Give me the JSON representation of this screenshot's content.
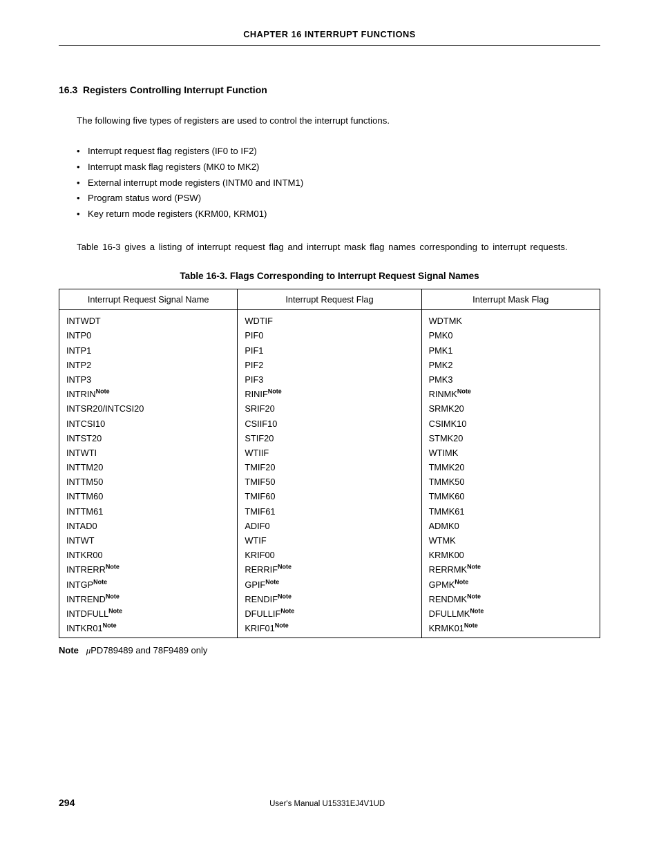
{
  "header": {
    "running": "CHAPTER  16   INTERRUPT  FUNCTIONS"
  },
  "section": {
    "number": "16.3",
    "title": "Registers Controlling Interrupt Function"
  },
  "intro": "The following five types of registers are used to control the interrupt functions.",
  "bullets": [
    "Interrupt request flag registers (IF0 to IF2)",
    "Interrupt mask flag registers (MK0 to MK2)",
    "External interrupt mode registers (INTM0 and INTM1)",
    "Program status word (PSW)",
    "Key return mode registers (KRM00, KRM01)"
  ],
  "paragraph": "Table 16-3 gives a listing of interrupt request flag and interrupt mask flag names corresponding to interrupt requests.",
  "table": {
    "caption": "Table 16-3.  Flags Corresponding to Interrupt Request Signal Names",
    "headers": [
      "Interrupt Request Signal Name",
      "Interrupt Request Flag",
      "Interrupt Mask Flag"
    ],
    "rows": [
      {
        "sig": "INTWDT",
        "req": "WDTIF",
        "mask": "WDTMK"
      },
      {
        "sig": "INTP0",
        "req": "PIF0",
        "mask": "PMK0"
      },
      {
        "sig": "INTP1",
        "req": "PIF1",
        "mask": "PMK1"
      },
      {
        "sig": "INTP2",
        "req": "PIF2",
        "mask": "PMK2"
      },
      {
        "sig": "INTP3",
        "req": "PIF3",
        "mask": "PMK3"
      },
      {
        "sig": "INTRIN",
        "sigNote": true,
        "req": "RINIF",
        "reqNote": true,
        "mask": "RINMK",
        "maskNote": true
      },
      {
        "sig": "INTSR20/INTCSI20",
        "req": "SRIF20",
        "mask": "SRMK20"
      },
      {
        "sig": "INTCSI10",
        "req": "CSIIF10",
        "mask": "CSIMK10"
      },
      {
        "sig": "INTST20",
        "req": "STIF20",
        "mask": "STMK20"
      },
      {
        "sig": "INTWTI",
        "req": "WTIIF",
        "mask": "WTIMK"
      },
      {
        "sig": "INTTM20",
        "req": "TMIF20",
        "mask": "TMMK20"
      },
      {
        "sig": "INTTM50",
        "req": "TMIF50",
        "mask": "TMMK50"
      },
      {
        "sig": "INTTM60",
        "req": "TMIF60",
        "mask": "TMMK60"
      },
      {
        "sig": "INTTM61",
        "req": "TMIF61",
        "mask": "TMMK61"
      },
      {
        "sig": "INTAD0",
        "req": "ADIF0",
        "mask": "ADMK0"
      },
      {
        "sig": "INTWT",
        "req": "WTIF",
        "mask": "WTMK"
      },
      {
        "sig": "INTKR00",
        "req": "KRIF00",
        "mask": "KRMK00"
      },
      {
        "sig": "INTRERR",
        "sigNote": true,
        "req": "RERRIF",
        "reqNote": true,
        "mask": "RERRMK",
        "maskNote": true
      },
      {
        "sig": "INTGP",
        "sigNote": true,
        "req": "GPIF",
        "reqNote": true,
        "mask": "GPMK",
        "maskNote": true
      },
      {
        "sig": "INTREND",
        "sigNote": true,
        "req": "RENDIF",
        "reqNote": true,
        "mask": "RENDMK",
        "maskNote": true
      },
      {
        "sig": "INTDFULL",
        "sigNote": true,
        "req": "DFULLIF",
        "reqNote": true,
        "mask": "DFULLMK",
        "maskNote": true
      },
      {
        "sig": "INTKR01",
        "sigNote": true,
        "req": "KRIF01",
        "reqNote": true,
        "mask": "KRMK01",
        "maskNote": true
      }
    ]
  },
  "note": {
    "label": "Note",
    "sup": "Note",
    "text": "PD789489 and 78F9489 only"
  },
  "footer": {
    "page": "294",
    "manual": "User's Manual  U15331EJ4V1UD"
  }
}
